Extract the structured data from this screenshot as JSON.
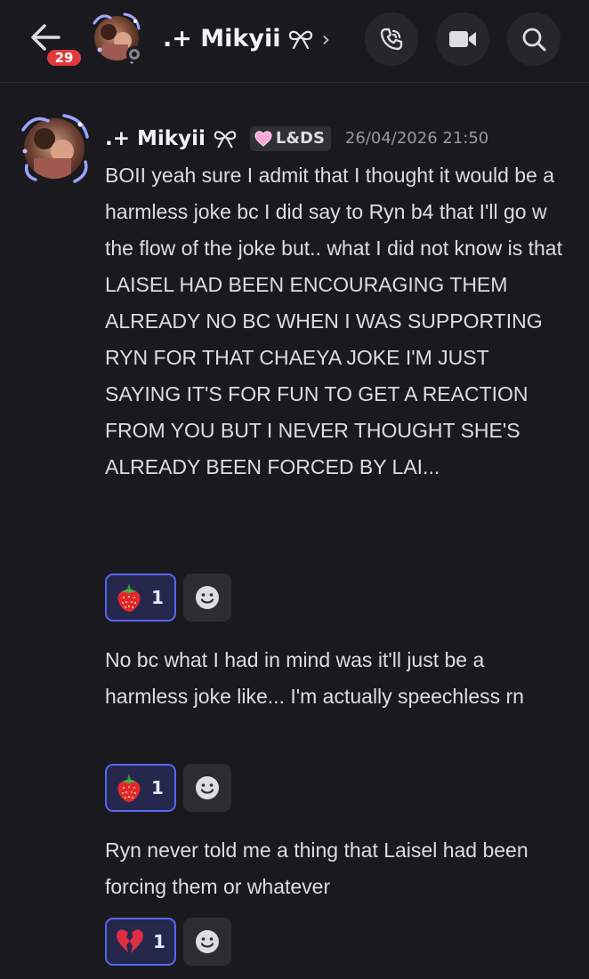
{
  "header": {
    "unread_badge": "29",
    "channel_name": ".+ Mikyii",
    "chevron": "›",
    "icons": {
      "back": "arrow-left-icon",
      "call": "phone-icon",
      "video": "video-camera-icon",
      "search": "search-icon"
    }
  },
  "message": {
    "author": ".+ Mikyii",
    "author_icon": "bow-icon",
    "tag_label": "L&DS",
    "tag_icon": "pink-heart-icon",
    "timestamp": "26/04/2026 21:50"
  },
  "messages": [
    {
      "text": "BOII yeah sure I admit that I thought it would be a harmless joke bc I did say to Ryn b4 that I'll go w the flow of the joke but.. what I did not know is that LAISEL HAD BEEN ENCOURAGING THEM ALREADY NO BC WHEN I WAS SUPPORTING RYN FOR THAT CHAEYA JOKE I'M JUST SAYING IT'S FOR FUN TO GET A REACTION FROM YOU BUT I NEVER THOUGHT SHE'S ALREADY BEEN FORCED BY LAI...",
      "reaction_emoji": "strawberry-icon",
      "reaction_count": "1"
    },
    {
      "text": "No bc what I had in mind was it'll just be a harmless joke like... I'm actually speechless rn",
      "reaction_emoji": "strawberry-icon",
      "reaction_count": "1"
    },
    {
      "text": "Ryn never told me a thing that Laisel had been forcing them or whatever",
      "reaction_emoji": "broken-heart-icon",
      "reaction_count": "1"
    }
  ],
  "colors": {
    "background": "#1a1a1e",
    "accent": "#5865f2",
    "badge": "#e03a3e",
    "text": "#dbdee1",
    "muted": "#949ba4"
  }
}
